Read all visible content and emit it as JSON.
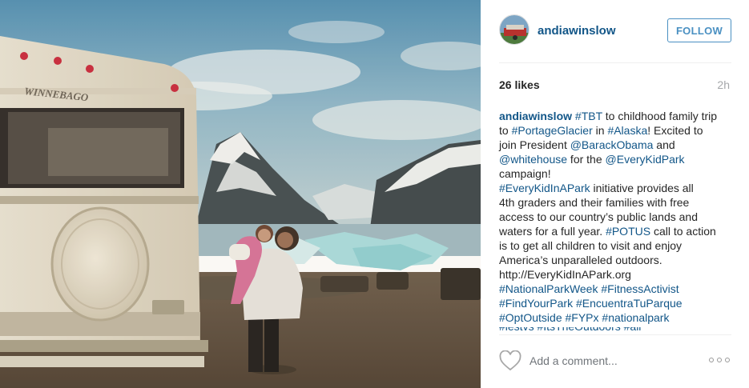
{
  "post": {
    "image_alt": "Vintage photo of a woman holding a child next to a Winnebago RV in front of Portage Glacier, Alaska",
    "rv_brand_text": "WINNEBAGO"
  },
  "header": {
    "username": "andiawinslow",
    "follow_label": "FOLLOW"
  },
  "meta": {
    "likes": "26 likes",
    "time": "2h"
  },
  "caption": {
    "lines": [
      [
        {
          "t": "andiawinslow",
          "k": "user"
        },
        {
          "t": " ",
          "k": "text"
        },
        {
          "t": "#TBT",
          "k": "tag"
        },
        {
          "t": " to childhood family trip",
          "k": "text"
        }
      ],
      [
        {
          "t": "to ",
          "k": "text"
        },
        {
          "t": "#PortageGlacier",
          "k": "tag"
        },
        {
          "t": " in ",
          "k": "text"
        },
        {
          "t": "#Alaska",
          "k": "tag"
        },
        {
          "t": "! Excited to",
          "k": "text"
        }
      ],
      [
        {
          "t": "join President ",
          "k": "text"
        },
        {
          "t": "@BarackObama",
          "k": "tag"
        },
        {
          "t": " and",
          "k": "text"
        }
      ],
      [
        {
          "t": "@whitehouse",
          "k": "tag"
        },
        {
          "t": " for the ",
          "k": "text"
        },
        {
          "t": "@EveryKidPark",
          "k": "tag"
        }
      ],
      [
        {
          "t": "campaign!",
          "k": "text"
        }
      ],
      [
        {
          "t": "#EveryKidInAPark",
          "k": "tag"
        },
        {
          "t": " initiative provides all",
          "k": "text"
        }
      ],
      [
        {
          "t": "4th graders and their families with free",
          "k": "text"
        }
      ],
      [
        {
          "t": "access to our country’s public lands and",
          "k": "text"
        }
      ],
      [
        {
          "t": "waters for a full year. ",
          "k": "text"
        },
        {
          "t": "#POTUS",
          "k": "tag"
        },
        {
          "t": " call to action",
          "k": "text"
        }
      ],
      [
        {
          "t": "is to get all children to visit and enjoy",
          "k": "text"
        }
      ],
      [
        {
          "t": "America’s unparalleled outdoors.",
          "k": "text"
        }
      ],
      [
        {
          "t": "http://EveryKidInAPark.org",
          "k": "text"
        }
      ],
      [
        {
          "t": "#NationalParkWeek",
          "k": "tag"
        },
        {
          "t": " ",
          "k": "text"
        },
        {
          "t": "#FitnessActivist",
          "k": "tag"
        }
      ],
      [
        {
          "t": "#FindYourPark",
          "k": "tag"
        },
        {
          "t": " ",
          "k": "text"
        },
        {
          "t": "#EncuentraTuParque",
          "k": "tag"
        }
      ],
      [
        {
          "t": "#OptOutside",
          "k": "tag"
        },
        {
          "t": " ",
          "k": "text"
        },
        {
          "t": "#FYPx",
          "k": "tag"
        },
        {
          "t": " ",
          "k": "text"
        },
        {
          "t": "#nationalpark",
          "k": "tag"
        }
      ]
    ],
    "cut_off_text": "#lestvs #ItsTheOutdoors #all"
  },
  "comment": {
    "placeholder": "Add a comment...",
    "like_icon": "heart-outline-icon",
    "more_icon": "more-options-icon"
  },
  "colors": {
    "link": "#125688",
    "follow": "#4a90c2",
    "muted": "#a5a7aa"
  }
}
